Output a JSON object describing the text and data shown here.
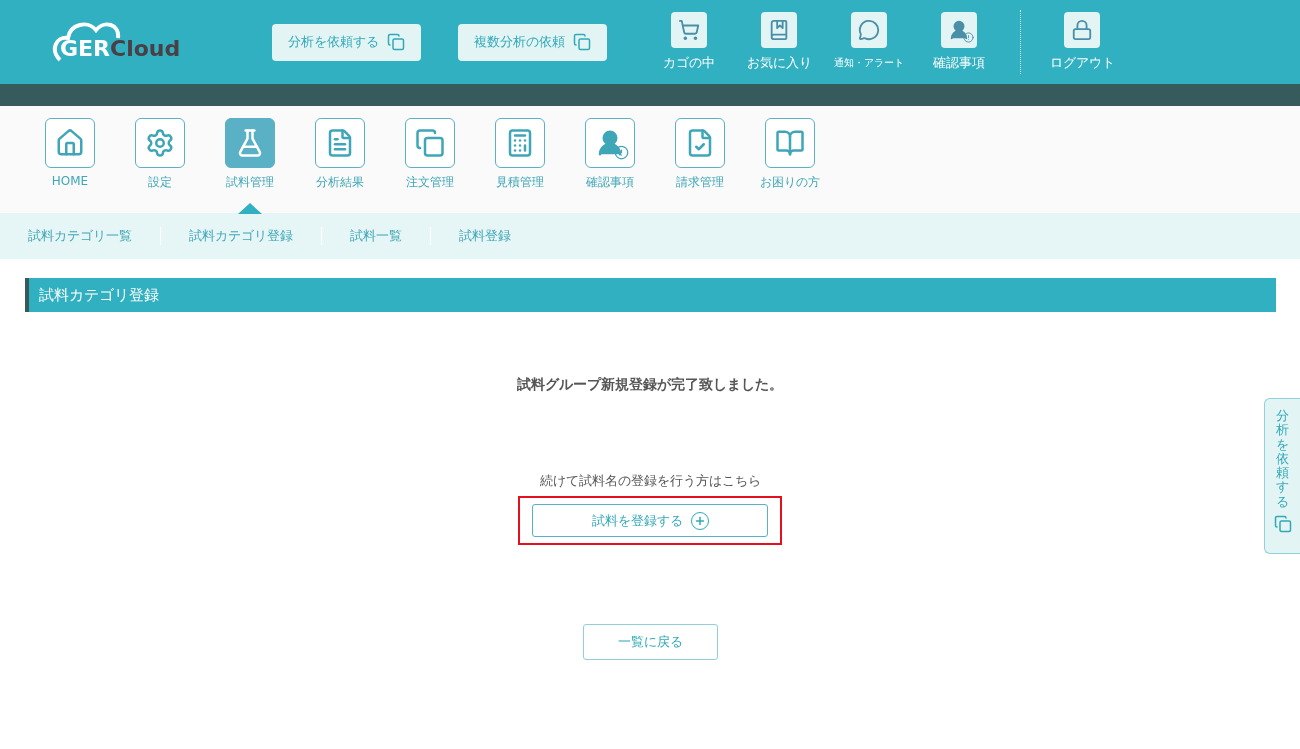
{
  "logo": {
    "first": "GER",
    "second": "Cloud"
  },
  "header_buttons": [
    {
      "label": "分析を依頼する"
    },
    {
      "label": "複数分析の依頼"
    }
  ],
  "header_links": [
    {
      "kind": "cart",
      "label": "カゴの中",
      "small": false
    },
    {
      "kind": "favorite",
      "label": "お気に入り",
      "small": false
    },
    {
      "kind": "notice",
      "label": "通知・アラート",
      "small": true
    },
    {
      "kind": "confirm",
      "label": "確認事項",
      "small": false
    },
    {
      "kind": "logout",
      "label": "ログアウト",
      "small": false
    }
  ],
  "main_nav": [
    {
      "kind": "home",
      "label": "HOME",
      "selected": false
    },
    {
      "kind": "settings",
      "label": "設定",
      "selected": false
    },
    {
      "kind": "flask",
      "label": "試料管理",
      "selected": true
    },
    {
      "kind": "result",
      "label": "分析結果",
      "selected": false
    },
    {
      "kind": "order",
      "label": "注文管理",
      "selected": false
    },
    {
      "kind": "estimate",
      "label": "見積管理",
      "selected": false
    },
    {
      "kind": "confirm",
      "label": "確認事項",
      "selected": false
    },
    {
      "kind": "invoice",
      "label": "請求管理",
      "selected": false
    },
    {
      "kind": "help",
      "label": "お困りの方",
      "selected": false
    }
  ],
  "sub_nav": [
    "試料カテゴリ一覧",
    "試料カテゴリ登録",
    "試料一覧",
    "試料登録"
  ],
  "section_title": "試料カテゴリ登録",
  "message": "試料グループ新規登録が完了致しました。",
  "continue_text": "続けて試料名の登録を行う方はこちら",
  "register_button": {
    "label": "試料を登録する",
    "highlighted": true
  },
  "back_button": "一覧に戻る",
  "side_tab": "分析を依頼する"
}
